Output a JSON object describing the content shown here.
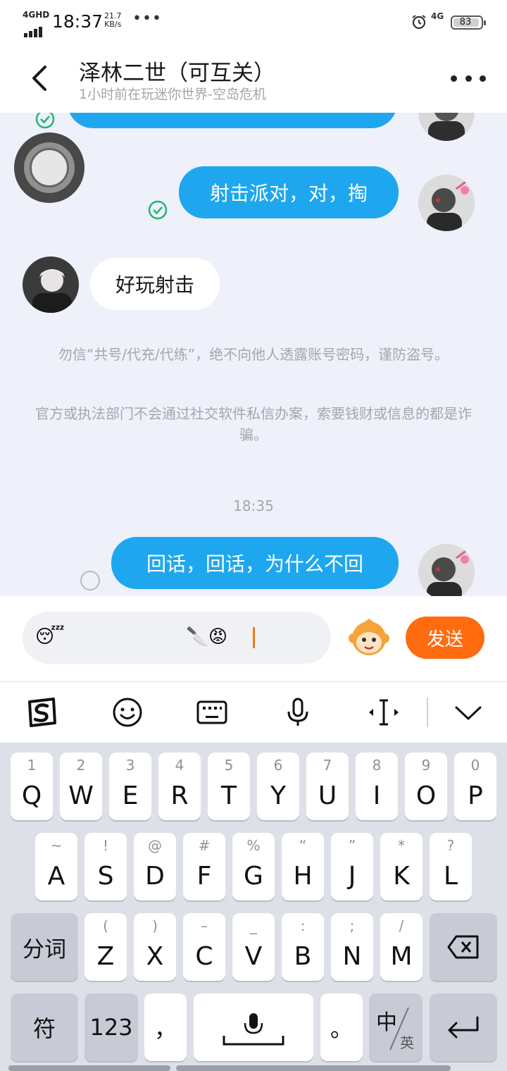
{
  "status_bar": {
    "network": "4GHD",
    "time": "18:37",
    "speed_value": "21.7",
    "speed_unit": "KB/s",
    "overflow": "•••",
    "right_network": "4G",
    "battery": "83"
  },
  "header": {
    "title": "泽林二世（可互关）",
    "subtitle": "1小时前在玩迷你世界-空岛危机"
  },
  "messages": [
    {
      "direction": "out",
      "text": "射击派对，对，掏",
      "status": "read"
    },
    {
      "direction": "in",
      "text": "好玩射击"
    },
    {
      "direction": "out",
      "text": "回话，回话，为什么不回",
      "status": "sending"
    }
  ],
  "notices": [
    "勿信“共号/代充/代练”，绝不向他人透露账号密码，谨防盗号。",
    "官方或执法部门不会通过社交软件私信办案，索要钱财或信息的都是诈骗。"
  ],
  "timestamp": "18:35",
  "input": {
    "emoji_left": "😴",
    "emoji_knife": "🔪",
    "emoji_angry": "😡",
    "send_label": "发送"
  },
  "keyboard": {
    "row1": [
      {
        "main": "Q",
        "sub": "1"
      },
      {
        "main": "W",
        "sub": "2"
      },
      {
        "main": "E",
        "sub": "3"
      },
      {
        "main": "R",
        "sub": "4"
      },
      {
        "main": "T",
        "sub": "5"
      },
      {
        "main": "Y",
        "sub": "6"
      },
      {
        "main": "U",
        "sub": "7"
      },
      {
        "main": "I",
        "sub": "8"
      },
      {
        "main": "O",
        "sub": "9"
      },
      {
        "main": "P",
        "sub": "0"
      }
    ],
    "row2": [
      {
        "main": "A",
        "sub": "~"
      },
      {
        "main": "S",
        "sub": "!"
      },
      {
        "main": "D",
        "sub": "@"
      },
      {
        "main": "F",
        "sub": "#"
      },
      {
        "main": "G",
        "sub": "%"
      },
      {
        "main": "H",
        "sub": "“"
      },
      {
        "main": "J",
        "sub": "”"
      },
      {
        "main": "K",
        "sub": "*"
      },
      {
        "main": "L",
        "sub": "?"
      }
    ],
    "row3": [
      {
        "main": "Z",
        "sub": "("
      },
      {
        "main": "X",
        "sub": ")"
      },
      {
        "main": "C",
        "sub": "–"
      },
      {
        "main": "V",
        "sub": "_"
      },
      {
        "main": "B",
        "sub": ":"
      },
      {
        "main": "N",
        "sub": ";"
      },
      {
        "main": "M",
        "sub": "/"
      }
    ],
    "segment_label": "分词",
    "symbol_label": "符",
    "number_label": "123",
    "comma_label": "，",
    "period_label": "。",
    "lang_main": "中",
    "lang_sub": "英"
  },
  "icons": {
    "back": "back-arrow-icon",
    "more": "more-dots-icon",
    "sogou": "sogou-logo-icon",
    "emoji": "smiley-icon",
    "keyboard": "keyboard-icon",
    "mic": "microphone-icon",
    "cursor": "cursor-move-icon",
    "collapse": "chevron-down-icon",
    "backspace": "backspace-icon",
    "enter": "enter-icon"
  },
  "colors": {
    "accent_blue": "#1ea7ef",
    "send_orange": "#ff6b0f",
    "read_green": "#22b573"
  }
}
